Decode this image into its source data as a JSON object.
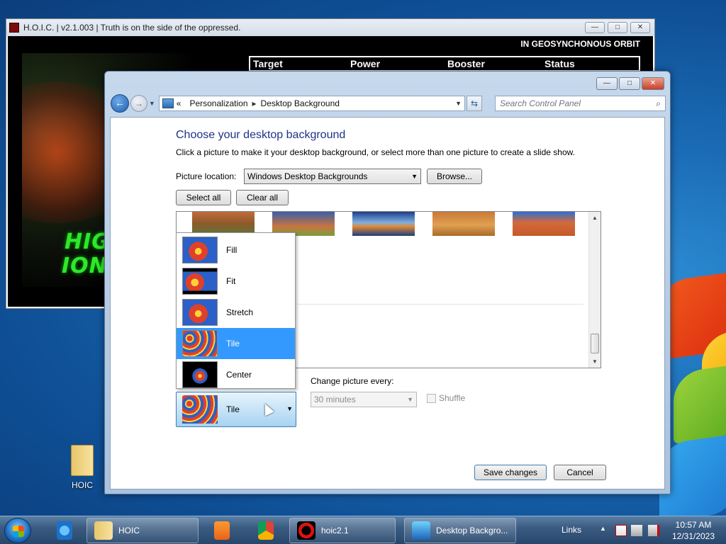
{
  "desktop": {
    "icon_label": "HOIC"
  },
  "hoic_window": {
    "title": "H.O.I.C. | v2.1.003 | Truth is on the side of the oppressed.",
    "orbit_status": "IN GEOSYNCHONOUS ORBIT",
    "art_text": "HIGH ORBIT ION CANNON",
    "art_text_visible": [
      "HIG",
      "ION C"
    ],
    "columns": [
      "Target",
      "Power",
      "Booster",
      "Status"
    ]
  },
  "cp_window": {
    "breadcrumb": [
      "Personalization",
      "Desktop Background"
    ],
    "search_placeholder": "Search Control Panel",
    "heading": "Choose your desktop background",
    "subtext": "Click a picture to make it your desktop background, or select more than one picture to create a slide show.",
    "picture_location_label": "Picture location:",
    "picture_location_value": "Windows Desktop Backgrounds",
    "browse_label": "Browse...",
    "select_all_label": "Select all",
    "clear_all_label": "Clear all",
    "position": {
      "selected": "Tile",
      "options": [
        {
          "label": "Fill",
          "icon": "fill-preview"
        },
        {
          "label": "Fit",
          "icon": "fit-preview"
        },
        {
          "label": "Stretch",
          "icon": "stretch-preview"
        },
        {
          "label": "Tile",
          "icon": "tile-preview",
          "selected": true
        },
        {
          "label": "Center",
          "icon": "center-preview"
        }
      ]
    },
    "change_picture_label": "Change picture every:",
    "interval_value": "30 minutes",
    "shuffle_label": "Shuffle",
    "save_label": "Save changes",
    "cancel_label": "Cancel"
  },
  "taskbar": {
    "items": [
      {
        "label": "HOIC",
        "icon": "folder-icon"
      },
      {
        "label": "hoic2.1",
        "icon": "hoic-icon"
      },
      {
        "label": "Desktop Backgro...",
        "icon": "desktop-background-icon",
        "active": true
      }
    ],
    "links_label": "Links",
    "time": "10:57 AM",
    "date": "12/31/2023"
  },
  "colors": {
    "heading": "#1e3287",
    "selection": "#3399ff",
    "hoic_green": "#2ee82a"
  }
}
